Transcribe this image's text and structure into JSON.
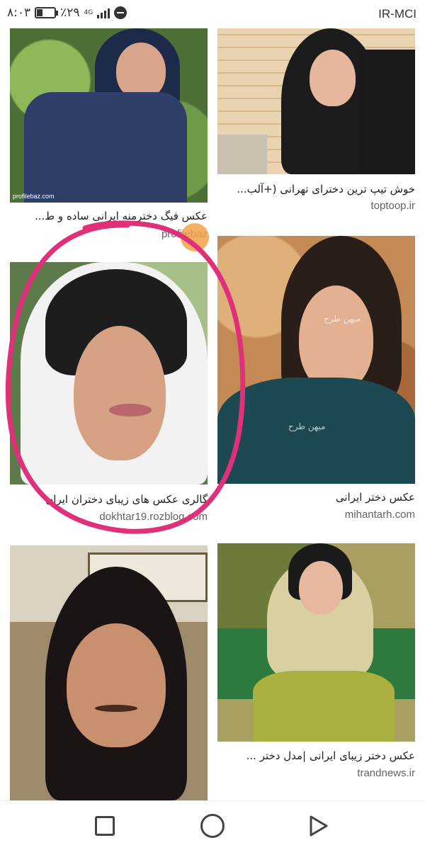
{
  "status_bar": {
    "time": "۸:۰۳",
    "battery_percent": "٪۲۹",
    "battery_level": 0.29,
    "network": "4G",
    "carrier": "IR-MCI",
    "battery_icon": "battery-icon",
    "signal_icon": "signal-icon",
    "dnd_icon": "do-not-disturb-icon"
  },
  "results": [
    {
      "caption": "عکس فیگ دخترمنه ایرانی ساده و ط...",
      "source": "profilebaz"
    },
    {
      "caption": "خوش تیپ ترین دخترای تهرانی (+آلب...",
      "source": "toptoop.ir"
    },
    {
      "caption": "گالری عکس های زیبای دختران ایران",
      "source": "dokhtar19.rozblog.com"
    },
    {
      "caption": "عکس دختر ایرانی",
      "source": "mihantarh.com"
    },
    {
      "caption": "",
      "source": ""
    },
    {
      "caption": "عکس دختر زیبای ایرانی |مدل دختر ...",
      "source": "trandnews.ir"
    }
  ],
  "watermarks": {
    "profile_tile": "profilebaz.com",
    "mihan_tile": "میهن طرح"
  },
  "annotation_color": "#e0307a",
  "nav": {
    "recents_icon": "square-recents-icon",
    "home_icon": "circle-home-icon",
    "back_icon": "triangle-back-icon"
  }
}
